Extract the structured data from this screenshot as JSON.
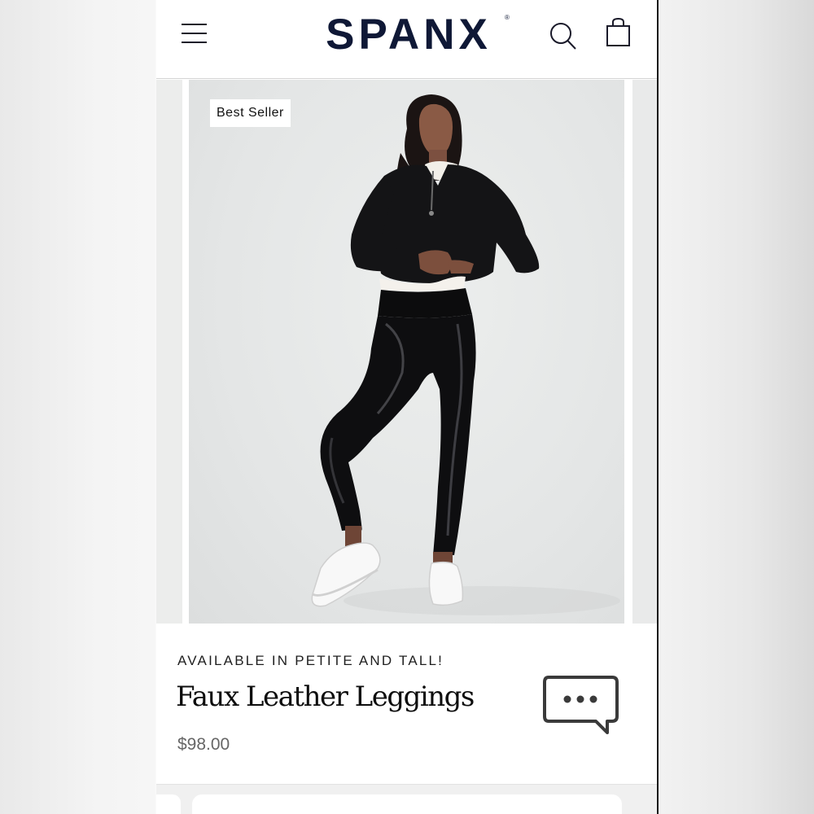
{
  "header": {
    "logo_text": "SPANX",
    "logo_mark": "®",
    "menu_icon": "hamburger-menu-icon",
    "search_icon": "search-icon",
    "bag_icon": "shopping-bag-icon"
  },
  "product": {
    "badge": "Best Seller",
    "eyebrow": "AVAILABLE IN PETITE AND TALL!",
    "title": "Faux Leather Leggings",
    "price": "$98.00",
    "image_alt": "Model wearing black faux leather leggings, black half-zip sweatshirt and white sneakers"
  },
  "chat": {
    "icon": "chat-bubble-icon"
  },
  "colors": {
    "brand_navy": "#0f1836",
    "background": "#ffffff",
    "image_backdrop": "#e4e6e6",
    "price_gray": "#666666"
  }
}
